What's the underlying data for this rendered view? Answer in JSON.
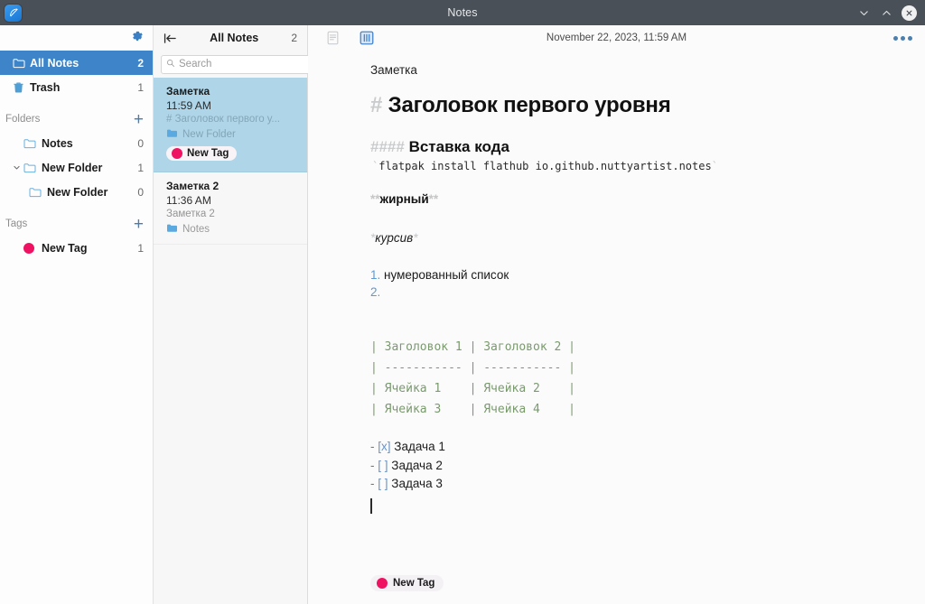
{
  "window": {
    "title": "Notes",
    "app_icon": "quill-icon",
    "controls": {
      "minimize": "chevron-down-icon",
      "maximize": "chevron-up-icon",
      "close": "close-icon"
    }
  },
  "sidebar": {
    "settings_icon": "gear-icon",
    "rows": [
      {
        "label": "All Notes",
        "count": "2",
        "icon": "folder-icon",
        "selected": true
      },
      {
        "label": "Trash",
        "count": "1",
        "icon": "trash-icon",
        "selected": false
      }
    ],
    "folders_section": {
      "title": "Folders",
      "add_label": "+"
    },
    "folders": [
      {
        "label": "Notes",
        "count": "0",
        "indent": 1,
        "twisty": "",
        "icon": "folder-icon"
      },
      {
        "label": "New Folder",
        "count": "1",
        "indent": 1,
        "twisty": "chevron-down-icon",
        "icon": "folder-icon"
      },
      {
        "label": "New Folder",
        "count": "0",
        "indent": 2,
        "twisty": "",
        "icon": "folder-icon"
      }
    ],
    "tags_section": {
      "title": "Tags",
      "add_label": "+"
    },
    "tags": [
      {
        "label": "New Tag",
        "count": "1",
        "color": "#ef1262"
      }
    ]
  },
  "notelist": {
    "collapse_icon": "collapse-panel-icon",
    "title": "All Notes",
    "count": "2",
    "search": {
      "placeholder": "Search",
      "value": "",
      "icon": "search-icon"
    },
    "add_label": "+",
    "items": [
      {
        "title": "Заметка",
        "time": "11:59 AM",
        "preview": "# Заголовок первого у...",
        "folder": "New Folder",
        "tag": "New Tag",
        "tag_color": "#ef1262",
        "selected": true
      },
      {
        "title": "Заметка 2",
        "time": "11:36 AM",
        "preview": "Заметка 2",
        "folder": "Notes",
        "tag": "",
        "tag_color": "",
        "selected": false
      }
    ]
  },
  "editor": {
    "view_list_icon": "document-view-icon",
    "view_split_icon": "split-view-icon",
    "date": "November 22, 2023, 11:59 AM",
    "menu_icon": "more-options-icon",
    "note_title": "Заметка",
    "h1_hash": "#",
    "h1_text": "Заголовок первого уровня",
    "h4_hash": "####",
    "h4_text": "Вставка кода",
    "code_tick_open": "`",
    "code_text": "flatpak install flathub io.github.nuttyartist.notes",
    "code_tick_close": "`",
    "bold_ticks_open": "**",
    "bold_text": "жирный",
    "bold_ticks_close": "**",
    "ital_ticks_open": "*",
    "ital_text": "курсив",
    "ital_ticks_close": "*",
    "ol": [
      {
        "num": "1.",
        "text": "нумерованный список"
      },
      {
        "num": "2.",
        "text": ""
      }
    ],
    "table": "| Заголовок 1 | Заголовок 2 |\n| ----------- | ----------- |\n| Ячейка 1    | Ячейка 2    |\n| Ячейка 3    | Ячейка 4    |",
    "tasks": [
      {
        "dash": "-",
        "box": "[x]",
        "text": "Задача 1"
      },
      {
        "dash": "-",
        "box": "[ ]",
        "text": "Задача 2"
      },
      {
        "dash": "-",
        "box": "[ ]",
        "text": "Задача 3"
      }
    ],
    "footer_tag": "New Tag",
    "footer_tag_color": "#ef1262"
  },
  "colors": {
    "titlebar": "#4a5058",
    "accent": "#3d85c8",
    "selected_note": "#afd5e8",
    "tag_pink": "#ef1262",
    "table_green": "#7a9a6e"
  }
}
